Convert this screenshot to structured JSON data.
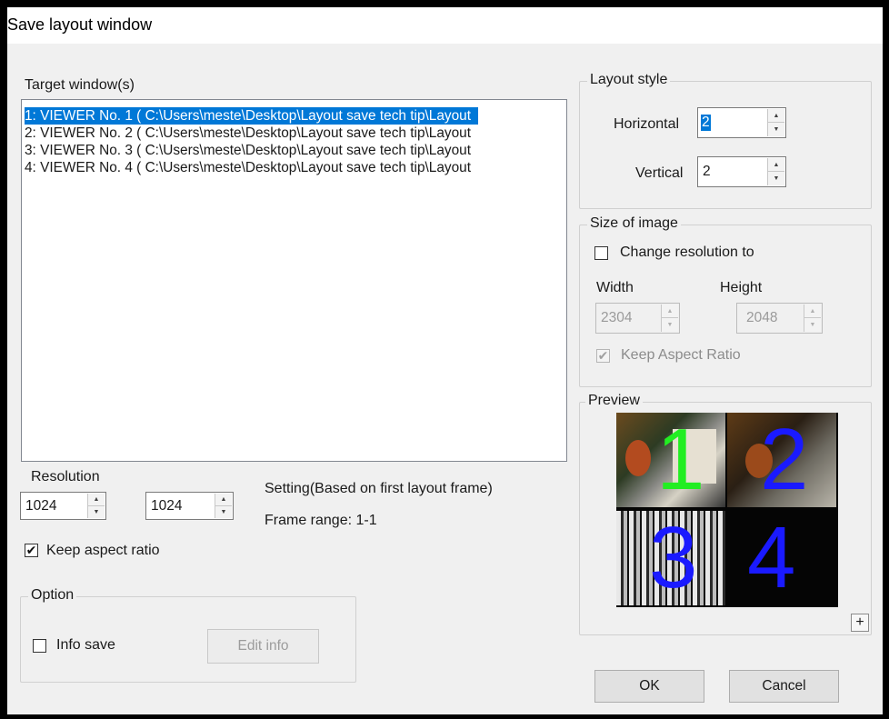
{
  "window": {
    "title": "Save layout window"
  },
  "targets": {
    "label": "Target window(s)",
    "items": [
      "1: VIEWER No. 1 ( C:\\Users\\meste\\Desktop\\Layout save tech tip\\Layout",
      "2: VIEWER No. 2 ( C:\\Users\\meste\\Desktop\\Layout save tech tip\\Layout",
      "3: VIEWER No. 3 ( C:\\Users\\meste\\Desktop\\Layout save tech tip\\Layout",
      "4: VIEWER No. 4 ( C:\\Users\\meste\\Desktop\\Layout save tech tip\\Layout"
    ],
    "selected_index": 0
  },
  "resolution": {
    "label": "Resolution",
    "width_value": "1024",
    "height_value": "1024",
    "keep_aspect_label": "Keep aspect ratio",
    "keep_aspect_checked": true
  },
  "setting": {
    "text": "Setting(Based on first layout frame)",
    "frame_range": "Frame range: 1-1"
  },
  "option": {
    "title": "Option",
    "info_save_label": "Info save",
    "info_save_checked": false,
    "edit_info_label": "Edit info"
  },
  "layout_style": {
    "title": "Layout style",
    "horizontal_label": "Horizontal",
    "horizontal_value": "2",
    "vertical_label": "Vertical",
    "vertical_value": "2"
  },
  "size_of_image": {
    "title": "Size of image",
    "change_resolution_label": "Change resolution to",
    "change_resolution_checked": false,
    "width_label": "Width",
    "height_label": "Height",
    "width_value": "2304",
    "height_value": "2048",
    "keep_aspect_label": "Keep Aspect Ratio",
    "keep_aspect_checked": true
  },
  "preview": {
    "title": "Preview",
    "tiles": [
      {
        "number": "1",
        "color": "#22ee22"
      },
      {
        "number": "2",
        "color": "#1a1aff"
      },
      {
        "number": "3",
        "color": "#1a1aff"
      },
      {
        "number": "4",
        "color": "#1a1aff"
      }
    ],
    "expand_label": "+"
  },
  "buttons": {
    "ok": "OK",
    "cancel": "Cancel"
  },
  "icons": {
    "spin_up": "spin-up-icon",
    "spin_down": "spin-down-icon",
    "check": "check-icon"
  }
}
